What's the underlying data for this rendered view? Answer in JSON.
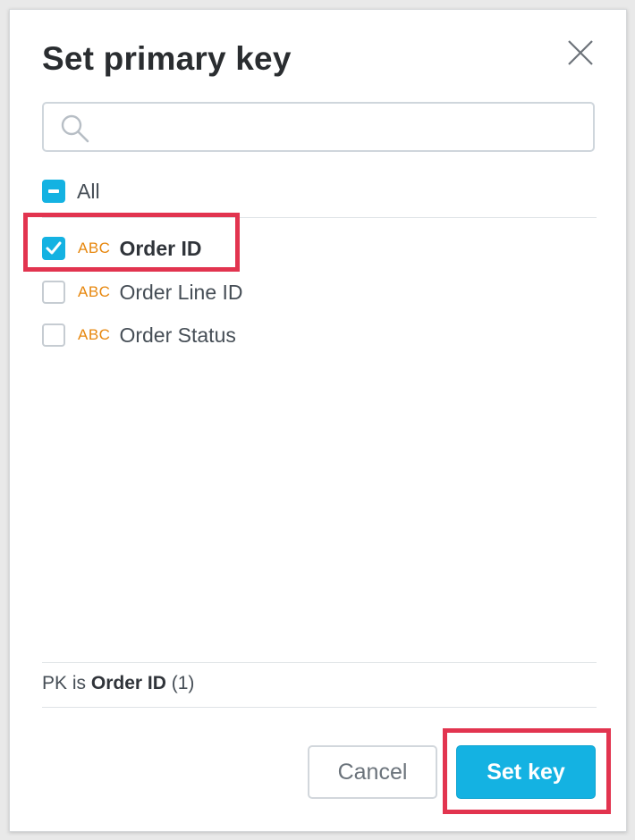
{
  "dialog": {
    "title": "Set primary key",
    "close_icon": "close-icon",
    "search": {
      "value": "",
      "placeholder": "",
      "icon": "search-icon"
    },
    "select_all": {
      "label": "All",
      "state": "partial"
    },
    "items": [
      {
        "type_badge": "ABC",
        "label": "Order ID",
        "checked": true
      },
      {
        "type_badge": "ABC",
        "label": "Order Line ID",
        "checked": false
      },
      {
        "type_badge": "ABC",
        "label": "Order Status",
        "checked": false
      }
    ],
    "footer": {
      "prefix": "PK is",
      "selected": "Order ID",
      "count": "(1)"
    },
    "buttons": {
      "cancel": "Cancel",
      "confirm": "Set key"
    }
  },
  "colors": {
    "accent": "#14b2e2",
    "type_badge": "#e7870e",
    "highlight": "#e2344f"
  }
}
